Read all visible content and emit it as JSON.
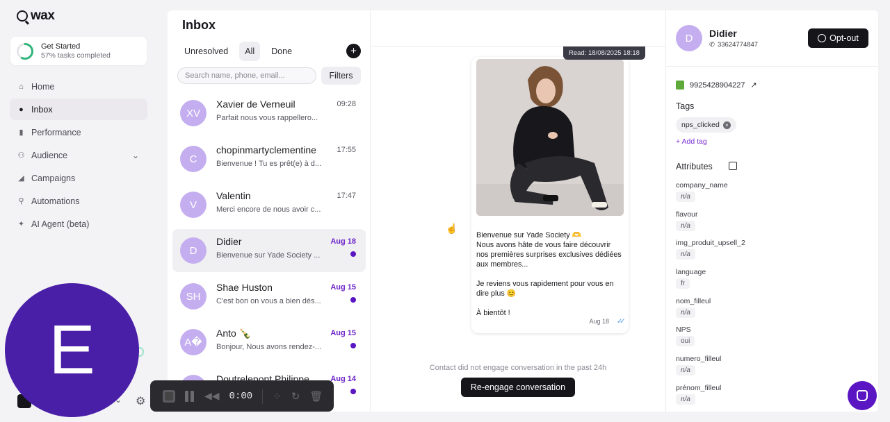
{
  "brand": {
    "name": "wax"
  },
  "get_started": {
    "title": "Get Started",
    "subtitle": "57% tasks completed",
    "progress": 0.57
  },
  "nav": [
    {
      "label": "Home",
      "icon": "home-icon"
    },
    {
      "label": "Inbox",
      "icon": "chat-icon",
      "active": true
    },
    {
      "label": "Performance",
      "icon": "chart-icon"
    },
    {
      "label": "Audience",
      "icon": "users-icon",
      "expandable": true
    },
    {
      "label": "Campaigns",
      "icon": "megaphone-icon"
    },
    {
      "label": "Automations",
      "icon": "flow-icon"
    },
    {
      "label": "AI Agent (beta)",
      "icon": "sparkle-icon"
    }
  ],
  "overlay_avatar": {
    "letter": "E"
  },
  "recorder": {
    "time": "0:00"
  },
  "inbox": {
    "title": "Inbox",
    "tabs": [
      "Unresolved",
      "All",
      "Done"
    ],
    "active_tab": "All",
    "search_placeholder": "Search name, phone, email...",
    "filters_label": "Filters",
    "add_label": "+",
    "conversations": [
      {
        "initials": "XV",
        "name": "Xavier de Verneuil",
        "preview": "Parfait nous vous rappellero...",
        "time": "09:28",
        "unread": false
      },
      {
        "initials": "C",
        "name": "chopinmartyclementine",
        "preview": "Bienvenue ! Tu es prêt(e) à d...",
        "time": "17:55",
        "unread": false
      },
      {
        "initials": "V",
        "name": "Valentin",
        "preview": "Merci encore de nous avoir c...",
        "time": "17:47",
        "unread": false
      },
      {
        "initials": "D",
        "name": "Didier",
        "preview": "Bienvenue sur Yade Society ...",
        "time": "Aug 18",
        "unread": true,
        "selected": true
      },
      {
        "initials": "SH",
        "name": "Shae Huston",
        "preview": "C'est bon on vous a bien dés...",
        "time": "Aug 15",
        "unread": true
      },
      {
        "initials": "A�",
        "name": "Anto 🍾",
        "preview": "Bonjour, Nous avons rendez-...",
        "time": "Aug 15",
        "unread": true
      },
      {
        "initials": "DP",
        "name": "Doutrelepont Philippe",
        "preview": "",
        "time": "Aug 14",
        "unread": true
      }
    ]
  },
  "chat": {
    "read_status": "Read: 18/08/2025 18:18",
    "message_text": "Bienvenue sur Yade Society 🫶\nNous avons hâte de vous faire découvrir nos premières surprises exclusives dédiées aux membres...\n\nJe reviens vous rapidement pour vous en dire plus 😊\n\nÀ bientôt !",
    "message_time": "Aug 18",
    "no_engage_notice": "Contact did not engage conversation in the past 24h",
    "reengage_label": "Re-engage conversation"
  },
  "contact": {
    "initials": "D",
    "name": "Didier",
    "phone": "33624774847",
    "optout_label": "Opt-out",
    "shop_id": "9925428904227",
    "tags_label": "Tags",
    "tags": [
      "nps_clicked"
    ],
    "add_tag_label": "+ Add tag",
    "attributes_label": "Attributes",
    "attributes": [
      {
        "name": "company_name",
        "value": "n/a"
      },
      {
        "name": "flavour",
        "value": "n/a"
      },
      {
        "name": "img_produit_upsell_2",
        "value": "n/a"
      },
      {
        "name": "language",
        "value": "fr"
      },
      {
        "name": "nom_filleul",
        "value": "n/a"
      },
      {
        "name": "NPS",
        "value": "oui"
      },
      {
        "name": "numero_filleul",
        "value": "n/a"
      },
      {
        "name": "prénom_filleul",
        "value": "n/a"
      }
    ]
  },
  "colors": {
    "accent": "#5a16c2",
    "avatar": "#c4aef0",
    "dark": "#15151a"
  }
}
